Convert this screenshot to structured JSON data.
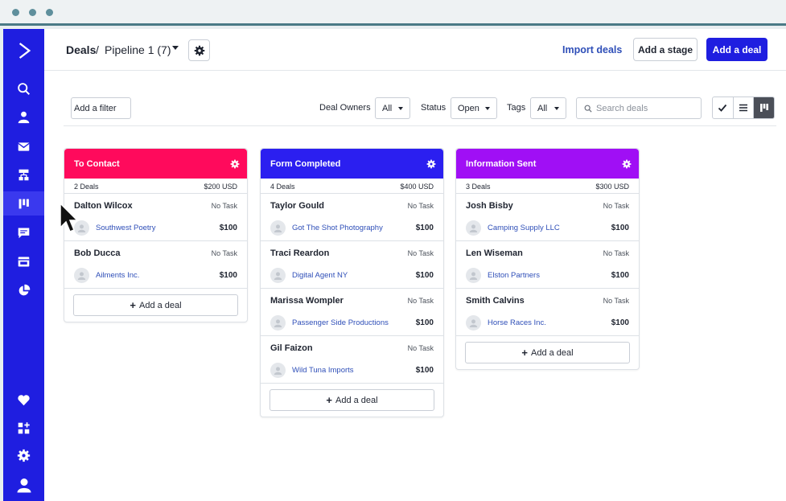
{
  "header": {
    "breadcrumb_root": "Deals",
    "breadcrumb_sep": "/",
    "pipeline_label": "Pipeline 1 (7)",
    "import_label": "Import deals",
    "add_stage_label": "Add a stage",
    "add_deal_label": "Add a deal"
  },
  "filters": {
    "add_filter_label": "Add a filter",
    "owners_label": "Deal Owners",
    "owners_value": "All",
    "status_label": "Status",
    "status_value": "Open",
    "tags_label": "Tags",
    "tags_value": "All",
    "search_placeholder": "Search deals"
  },
  "colors": {
    "brand": "#1f1ee0",
    "to_contact": "#ff0a5c",
    "form_completed": "#2b1ff0",
    "information_sent": "#a00ff5",
    "link": "#2f4fb8"
  },
  "columns": [
    {
      "title": "To Contact",
      "count": "2 Deals",
      "total": "$200 USD",
      "add_label": "Add a deal",
      "deals": [
        {
          "name": "Dalton Wilcox",
          "task": "No Task",
          "org": "Southwest Poetry",
          "value": "$100"
        },
        {
          "name": "Bob Ducca",
          "task": "No Task",
          "org": "Ailments Inc.",
          "value": "$100"
        }
      ]
    },
    {
      "title": "Form Completed",
      "count": "4 Deals",
      "total": "$400 USD",
      "add_label": "Add a deal",
      "deals": [
        {
          "name": "Taylor Gould",
          "task": "No Task",
          "org": "Got The Shot Photography",
          "value": "$100"
        },
        {
          "name": "Traci Reardon",
          "task": "No Task",
          "org": "Digital Agent NY",
          "value": "$100"
        },
        {
          "name": "Marissa Wompler",
          "task": "No Task",
          "org": "Passenger Side Productions",
          "value": "$100"
        },
        {
          "name": "Gil Faizon",
          "task": "No Task",
          "org": "Wild Tuna Imports",
          "value": "$100"
        }
      ]
    },
    {
      "title": "Information Sent",
      "count": "3 Deals",
      "total": "$300 USD",
      "add_label": "Add a deal",
      "deals": [
        {
          "name": "Josh Bisby",
          "task": "No Task",
          "org": "Camping Supply LLC",
          "value": "$100"
        },
        {
          "name": "Len Wiseman",
          "task": "No Task",
          "org": "Elston Partners",
          "value": "$100"
        },
        {
          "name": "Smith Calvins",
          "task": "No Task",
          "org": "Horse Races Inc.",
          "value": "$100"
        }
      ]
    }
  ]
}
